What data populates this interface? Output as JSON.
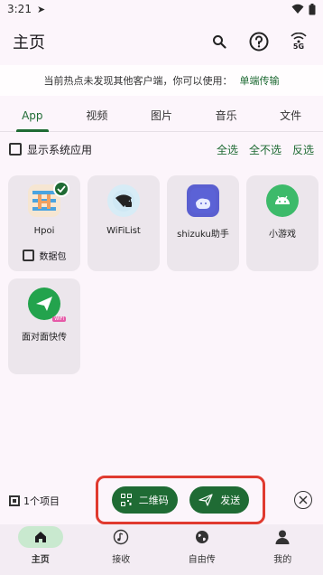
{
  "status_bar": {
    "time": "3:21"
  },
  "app_bar": {
    "title": "主页",
    "network_label": "5G"
  },
  "notice": {
    "text": "当前热点未发现其他客户端，你可以使用：",
    "link": "单端传输"
  },
  "tabs": [
    {
      "label": "App",
      "active": true
    },
    {
      "label": "视频",
      "active": false
    },
    {
      "label": "图片",
      "active": false
    },
    {
      "label": "音乐",
      "active": false
    },
    {
      "label": "文件",
      "active": false
    }
  ],
  "filter": {
    "show_system_label": "显示系统应用",
    "select_all": "全选",
    "select_none": "全不选",
    "invert": "反选"
  },
  "apps": [
    {
      "name": "Hpoi",
      "selected": true,
      "sub_label": "数据包"
    },
    {
      "name": "WiFiList",
      "selected": false
    },
    {
      "name": "shizuku助手",
      "selected": false
    },
    {
      "name": "小游戏",
      "selected": false
    },
    {
      "name": "面对面快传",
      "selected": false,
      "icon_tag": "WIFI"
    }
  ],
  "selection": {
    "count_label": "1个项目",
    "qr_label": "二维码",
    "send_label": "发送"
  },
  "colors": {
    "accent": "#1f6b34",
    "highlight_border": "#e03a2f"
  },
  "bottom_nav": [
    {
      "label": "主页",
      "icon": "home-icon",
      "active": true
    },
    {
      "label": "接收",
      "icon": "music-note-icon",
      "active": false
    },
    {
      "label": "自由传",
      "icon": "globe-icon",
      "active": false
    },
    {
      "label": "我的",
      "icon": "person-icon",
      "active": false
    }
  ]
}
